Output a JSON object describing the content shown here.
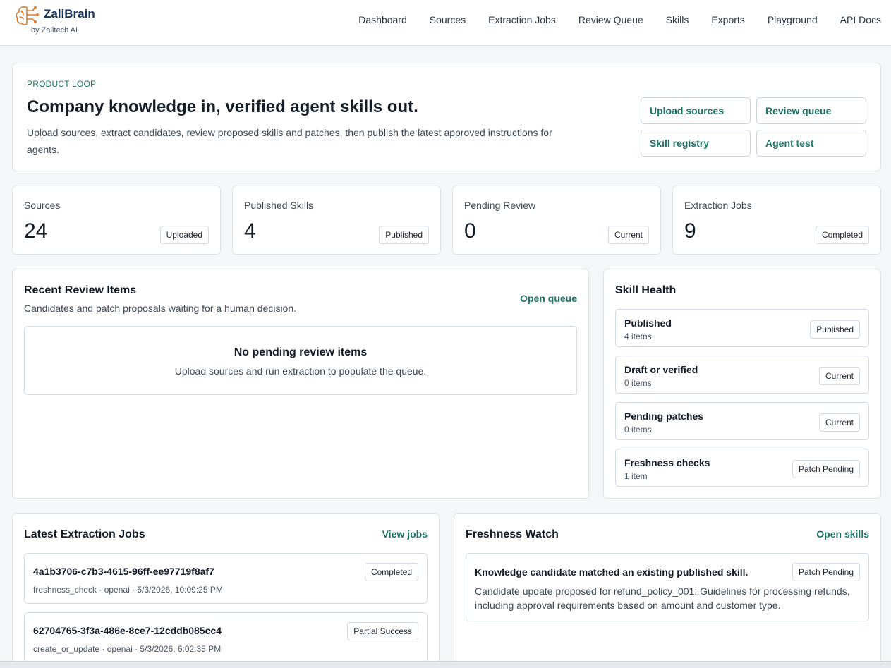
{
  "brand": {
    "name": "ZaliBrain",
    "sub": "by Zalitech AI",
    "accent": "#e07b2a"
  },
  "nav": [
    "Dashboard",
    "Sources",
    "Extraction Jobs",
    "Review Queue",
    "Skills",
    "Exports",
    "Playground",
    "API Docs"
  ],
  "hero": {
    "eyebrow": "PRODUCT LOOP",
    "title": "Company knowledge in, verified agent skills out.",
    "description": "Upload sources, extract candidates, review proposed skills and patches, then publish the latest approved instructions for agents.",
    "actions": [
      "Upload sources",
      "Review queue",
      "Skill registry",
      "Agent test"
    ]
  },
  "stats": [
    {
      "label": "Sources",
      "value": "24",
      "badge": "Uploaded"
    },
    {
      "label": "Published Skills",
      "value": "4",
      "badge": "Published"
    },
    {
      "label": "Pending Review",
      "value": "0",
      "badge": "Current"
    },
    {
      "label": "Extraction Jobs",
      "value": "9",
      "badge": "Completed"
    }
  ],
  "review": {
    "title": "Recent Review Items",
    "subtitle": "Candidates and patch proposals waiting for a human decision.",
    "link": "Open queue",
    "empty_title": "No pending review items",
    "empty_desc": "Upload sources and run extraction to populate the queue."
  },
  "health": {
    "title": "Skill Health",
    "items": [
      {
        "name": "Published",
        "count": "4 items",
        "badge": "Published"
      },
      {
        "name": "Draft or verified",
        "count": "0 items",
        "badge": "Current"
      },
      {
        "name": "Pending patches",
        "count": "0 items",
        "badge": "Current"
      },
      {
        "name": "Freshness checks",
        "count": "1 item",
        "badge": "Patch Pending"
      }
    ]
  },
  "jobs": {
    "title": "Latest Extraction Jobs",
    "link": "View jobs",
    "items": [
      {
        "id": "4a1b3706-c7b3-4615-96ff-ee97719f8af7",
        "meta": "freshness_check · openai · 5/3/2026, 10:09:25 PM",
        "badge": "Completed"
      },
      {
        "id": "62704765-3f3a-486e-8ce7-12cddb085cc4",
        "meta": "create_or_update · openai · 5/3/2026, 6:02:35 PM",
        "badge": "Partial Success"
      }
    ]
  },
  "freshness": {
    "title": "Freshness Watch",
    "link": "Open skills",
    "item": {
      "title": "Knowledge candidate matched an existing published skill.",
      "badge": "Patch Pending",
      "desc": "Candidate update proposed for refund_policy_001: Guidelines for processing refunds, including approval requirements based on amount and customer type."
    }
  }
}
